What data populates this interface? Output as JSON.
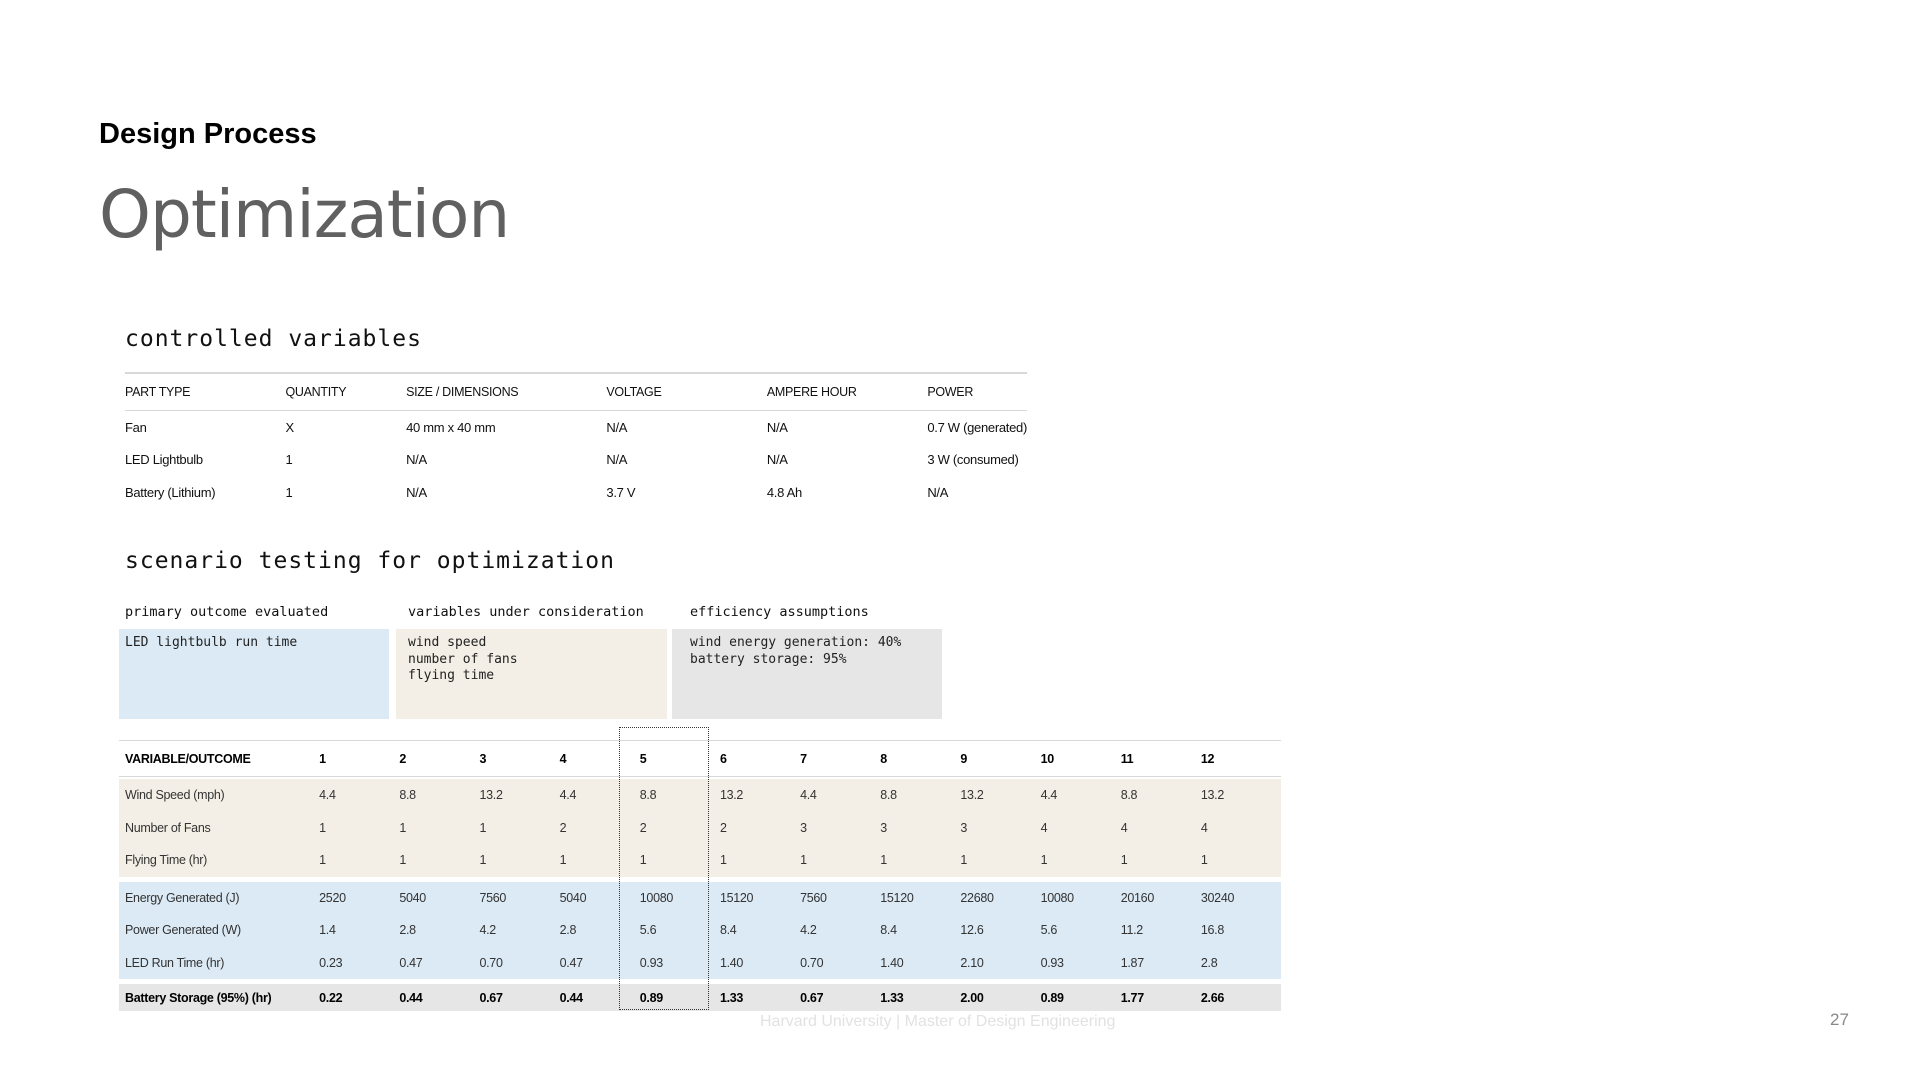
{
  "header": {
    "label": "Design Process",
    "title": "Optimization"
  },
  "controlled": {
    "heading": "controlled variables",
    "columns": [
      "PART TYPE",
      "QUANTITY",
      "SIZE / DIMENSIONS",
      "VOLTAGE",
      "AMPERE HOUR",
      "POWER"
    ],
    "rows": [
      [
        "Fan",
        "X",
        "40 mm x 40 mm",
        "N/A",
        "N/A",
        "0.7 W (generated)"
      ],
      [
        "LED Lightbulb",
        "1",
        "N/A",
        "N/A",
        "N/A",
        "3 W (consumed)"
      ],
      [
        "Battery (Lithium)",
        "1",
        "N/A",
        "3.7 V",
        "4.8 Ah",
        "N/A"
      ]
    ]
  },
  "scenario": {
    "heading": "scenario testing for optimization",
    "assumptions": {
      "primary_heading": "primary outcome evaluated",
      "primary_text": "LED lightbulb run time",
      "variables_heading": "variables under consideration",
      "variables_text": "wind speed\nnumber of fans\nflying time",
      "efficiency_heading": "efficiency assumptions",
      "efficiency_text": "wind energy generation: 40%\nbattery storage: 95%"
    },
    "table": {
      "header": [
        "VARIABLE/OUTCOME",
        "1",
        "2",
        "3",
        "4",
        "5",
        "6",
        "7",
        "8",
        "9",
        "10",
        "11",
        "12"
      ],
      "inputs": [
        [
          "Wind Speed (mph)",
          "4.4",
          "8.8",
          "13.2",
          "4.4",
          "8.8",
          "13.2",
          "4.4",
          "8.8",
          "13.2",
          "4.4",
          "8.8",
          "13.2"
        ],
        [
          "Number of Fans",
          "1",
          "1",
          "1",
          "2",
          "2",
          "2",
          "3",
          "3",
          "3",
          "4",
          "4",
          "4"
        ],
        [
          "Flying Time (hr)",
          "1",
          "1",
          "1",
          "1",
          "1",
          "1",
          "1",
          "1",
          "1",
          "1",
          "1",
          "1"
        ]
      ],
      "outputs": [
        [
          "Energy Generated (J)",
          "2520",
          "5040",
          "7560",
          "5040",
          "10080",
          "15120",
          "7560",
          "15120",
          "22680",
          "10080",
          "20160",
          "30240"
        ],
        [
          "Power Generated (W)",
          "1.4",
          "2.8",
          "4.2",
          "2.8",
          "5.6",
          "8.4",
          "4.2",
          "8.4",
          "12.6",
          "5.6",
          "11.2",
          "16.8"
        ],
        [
          "LED Run Time (hr)",
          "0.23",
          "0.47",
          "0.70",
          "0.47",
          "0.93",
          "1.40",
          "0.70",
          "1.40",
          "2.10",
          "0.93",
          "1.87",
          "2.8"
        ]
      ],
      "battery": [
        "Battery Storage (95%) (hr)",
        "0.22",
        "0.44",
        "0.67",
        "0.44",
        "0.89",
        "1.33",
        "0.67",
        "1.33",
        "2.00",
        "0.89",
        "1.77",
        "2.66"
      ],
      "highlighted_scenario": "5"
    }
  },
  "footer": {
    "text": "Harvard University  |  Master of Design Engineering",
    "page_number": "27"
  }
}
